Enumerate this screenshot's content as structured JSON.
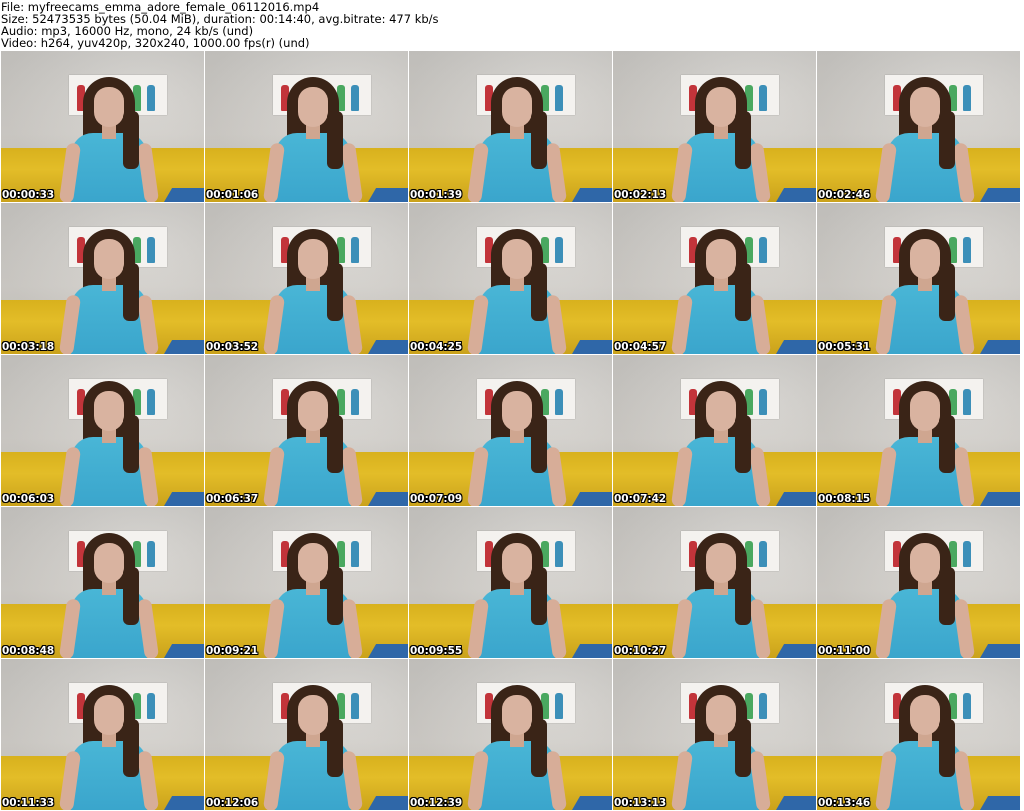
{
  "header": {
    "file_line": "File: myfreecams_emma_adore_female_06112016.mp4",
    "size_line": "Size: 52473535 bytes (50.04 MiB), duration: 00:14:40, avg.bitrate: 477 kb/s",
    "audio_line": "Audio: mp3, 16000 Hz, mono, 24 kb/s (und)",
    "video_line": "Video: h264, yuv420p, 320x240, 1000.00 fps(r) (und)"
  },
  "poster_colors": [
    "#c2343a",
    "#d63b5b",
    "#e0526b",
    "#e9c43a",
    "#4aa860",
    "#3c8fb8"
  ],
  "thumbnails": [
    {
      "timestamp": "00:00:33"
    },
    {
      "timestamp": "00:01:06"
    },
    {
      "timestamp": "00:01:39"
    },
    {
      "timestamp": "00:02:13"
    },
    {
      "timestamp": "00:02:46"
    },
    {
      "timestamp": "00:03:18"
    },
    {
      "timestamp": "00:03:52"
    },
    {
      "timestamp": "00:04:25"
    },
    {
      "timestamp": "00:04:57"
    },
    {
      "timestamp": "00:05:31"
    },
    {
      "timestamp": "00:06:03"
    },
    {
      "timestamp": "00:06:37"
    },
    {
      "timestamp": "00:07:09"
    },
    {
      "timestamp": "00:07:42"
    },
    {
      "timestamp": "00:08:15"
    },
    {
      "timestamp": "00:08:48"
    },
    {
      "timestamp": "00:09:21"
    },
    {
      "timestamp": "00:09:55"
    },
    {
      "timestamp": "00:10:27"
    },
    {
      "timestamp": "00:11:00"
    },
    {
      "timestamp": "00:11:33"
    },
    {
      "timestamp": "00:12:06"
    },
    {
      "timestamp": "00:12:39"
    },
    {
      "timestamp": "00:13:13"
    },
    {
      "timestamp": "00:13:46"
    }
  ]
}
